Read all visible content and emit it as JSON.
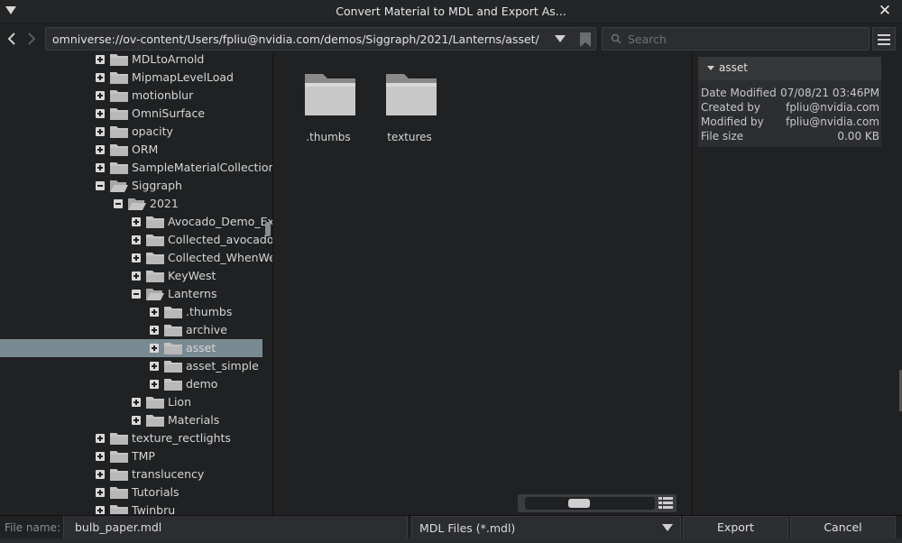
{
  "window": {
    "title": "Convert Material to MDL and Export As...",
    "close_glyph": "✕"
  },
  "toolbar": {
    "path": "omniverse://ov-content/Users/fpliu@nvidia.com/demos/Siggraph/2021/Lanterns/asset/",
    "search_placeholder": "Search",
    "icons": [
      "back-arrow-icon",
      "forward-arrow-icon",
      "dropdown-icon",
      "bookmark-icon",
      "search-icon",
      "menu-icon"
    ]
  },
  "tree": {
    "items": [
      {
        "label": "MDLtoArnold",
        "level": 0,
        "expanded": false,
        "open_folder": false,
        "selected": false
      },
      {
        "label": "MipmapLevelLoad",
        "level": 0,
        "expanded": false,
        "open_folder": false,
        "selected": false
      },
      {
        "label": "motionblur",
        "level": 0,
        "expanded": false,
        "open_folder": false,
        "selected": false
      },
      {
        "label": "OmniSurface",
        "level": 0,
        "expanded": false,
        "open_folder": false,
        "selected": false
      },
      {
        "label": "opacity",
        "level": 0,
        "expanded": false,
        "open_folder": false,
        "selected": false
      },
      {
        "label": "ORM",
        "level": 0,
        "expanded": false,
        "open_folder": false,
        "selected": false
      },
      {
        "label": "SampleMaterialCollection",
        "level": 0,
        "expanded": false,
        "open_folder": false,
        "selected": false
      },
      {
        "label": "Siggraph",
        "level": 0,
        "expanded": true,
        "open_folder": true,
        "selected": false
      },
      {
        "label": "2021",
        "level": 1,
        "expanded": true,
        "open_folder": true,
        "selected": false
      },
      {
        "label": "Avocado_Demo_Ex",
        "level": 2,
        "expanded": false,
        "open_folder": false,
        "selected": false
      },
      {
        "label": "Collected_avocado",
        "level": 2,
        "expanded": false,
        "open_folder": false,
        "selected": false
      },
      {
        "label": "Collected_WhenWe",
        "level": 2,
        "expanded": false,
        "open_folder": false,
        "selected": false
      },
      {
        "label": "KeyWest",
        "level": 2,
        "expanded": false,
        "open_folder": false,
        "selected": false
      },
      {
        "label": "Lanterns",
        "level": 2,
        "expanded": true,
        "open_folder": true,
        "selected": false
      },
      {
        "label": ".thumbs",
        "level": 3,
        "expanded": false,
        "open_folder": false,
        "selected": false
      },
      {
        "label": "archive",
        "level": 3,
        "expanded": false,
        "open_folder": false,
        "selected": false
      },
      {
        "label": "asset",
        "level": 3,
        "expanded": false,
        "open_folder": false,
        "selected": true
      },
      {
        "label": "asset_simple",
        "level": 3,
        "expanded": false,
        "open_folder": false,
        "selected": false
      },
      {
        "label": "demo",
        "level": 3,
        "expanded": false,
        "open_folder": false,
        "selected": false
      },
      {
        "label": "Lion",
        "level": 2,
        "expanded": false,
        "open_folder": false,
        "selected": false
      },
      {
        "label": "Materials",
        "level": 2,
        "expanded": false,
        "open_folder": false,
        "selected": false
      },
      {
        "label": "texture_rectlights",
        "level": 0,
        "expanded": false,
        "open_folder": false,
        "selected": false
      },
      {
        "label": "TMP",
        "level": 0,
        "expanded": false,
        "open_folder": false,
        "selected": false
      },
      {
        "label": "translucency",
        "level": 0,
        "expanded": false,
        "open_folder": false,
        "selected": false
      },
      {
        "label": "Tutorials",
        "level": 0,
        "expanded": false,
        "open_folder": false,
        "selected": false
      },
      {
        "label": "Twinbru",
        "level": 0,
        "expanded": false,
        "open_folder": false,
        "selected": false
      }
    ]
  },
  "content": {
    "files": [
      {
        "name": ".thumbs",
        "icon": "folder-icon"
      },
      {
        "name": "textures",
        "icon": "folder-icon"
      }
    ],
    "zoom_level": 0.5
  },
  "details": {
    "title": "asset",
    "rows": [
      {
        "key": "Date Modified",
        "value": "07/08/21 03:46PM"
      },
      {
        "key": "Created by",
        "value": "fpliu@nvidia.com"
      },
      {
        "key": "Modified by",
        "value": "fpliu@nvidia.com"
      },
      {
        "key": "File size",
        "value": "0.00 KB"
      }
    ]
  },
  "footer": {
    "file_name_label": "File name:",
    "file_name_value": "bulb_paper.mdl",
    "filter_value": "MDL Files (*.mdl)",
    "export_label": "Export",
    "cancel_label": "Cancel"
  },
  "colors": {
    "background": "#1f2123",
    "selection": "#7a8a92",
    "folder_light": "#c4c4c4",
    "folder_dark": "#8a8a8a"
  }
}
